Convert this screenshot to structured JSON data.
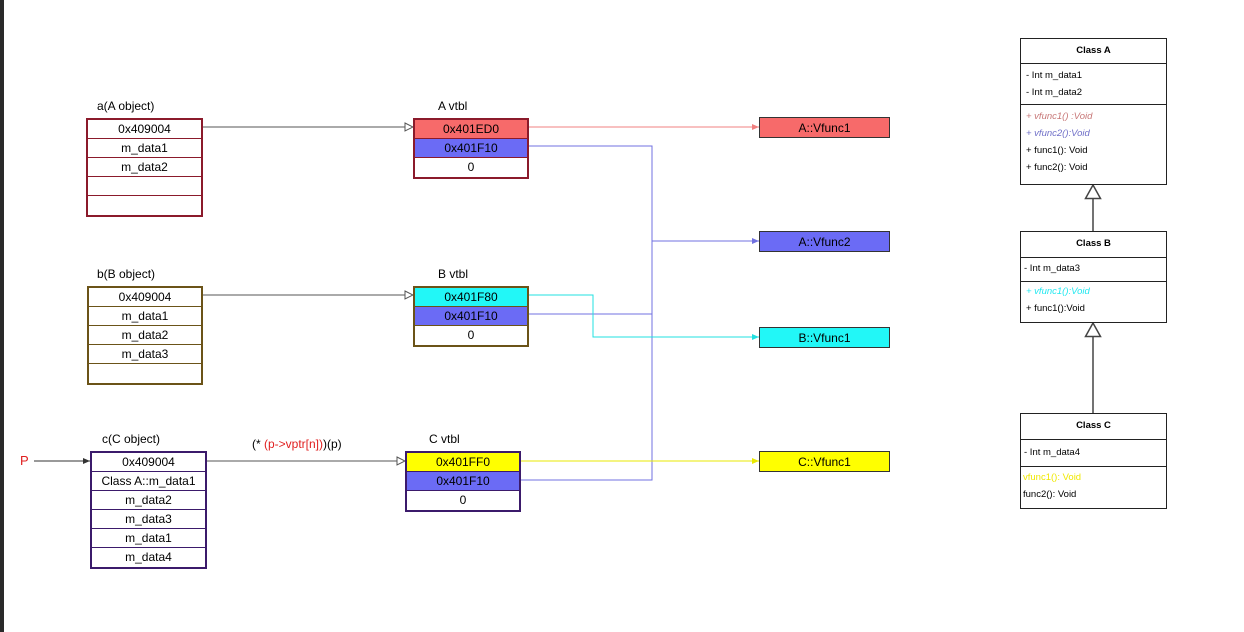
{
  "colors": {
    "red": "#f76a6a",
    "blue": "#6b6bf5",
    "cyan": "#22f7f7",
    "yellow": "#ffff00",
    "a_border": "#8b1a2b",
    "b_border": "#6b5318",
    "c_border": "#3b1a6b",
    "pointer_red": "#e02020"
  },
  "objects": {
    "a": {
      "title": "a(A object)",
      "rows": [
        "0x409004",
        "m_data1",
        "m_data2",
        "",
        ""
      ]
    },
    "b": {
      "title": "b(B object)",
      "rows": [
        "0x409004",
        "m_data1",
        "m_data2",
        "m_data3",
        ""
      ]
    },
    "c": {
      "title": "c(C object)",
      "rows": [
        "0x409004",
        "Class A::m_data1",
        "m_data2",
        "m_data3",
        "m_data1",
        "m_data4"
      ]
    }
  },
  "vtbls": {
    "a": {
      "title": "A vtbl",
      "rows": [
        "0x401ED0",
        "0x401F10",
        "0"
      ]
    },
    "b": {
      "title": "B vtbl",
      "rows": [
        "0x401F80",
        "0x401F10",
        "0"
      ]
    },
    "c": {
      "title": "C vtbl",
      "rows": [
        "0x401FF0",
        "0x401F10",
        "0"
      ]
    }
  },
  "functions": {
    "a_vfunc1": "A::Vfunc1",
    "a_vfunc2": "A::Vfunc2",
    "b_vfunc1": "B::Vfunc1",
    "c_vfunc1": "C::Vfunc1"
  },
  "pointer": {
    "label": "P",
    "call_prefix": "(* ",
    "call_mid": "(p->vptr[n])",
    "call_suffix": ")(p)"
  },
  "classes": {
    "a": {
      "name": "Class A",
      "attrs": [
        "-  Int m_data1",
        "-  Int m_data2"
      ],
      "methods": [
        "+  vfunc1() :Void",
        "+  vfunc2():Void",
        "+  func1(): Void",
        "+  func2(): Void"
      ]
    },
    "b": {
      "name": "Class B",
      "attrs": [
        "- Int m_data3"
      ],
      "methods": [
        "+ vfunc1():Void",
        "+ func1():Void"
      ]
    },
    "c": {
      "name": "Class C",
      "attrs": [
        "- Int m_data4"
      ],
      "methods": [
        "vfunc1(): Void",
        "func2(): Void"
      ]
    }
  }
}
